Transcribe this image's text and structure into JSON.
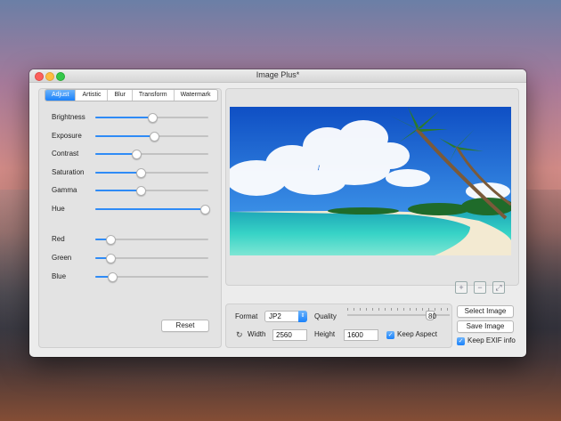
{
  "window": {
    "title": "Image Plus*"
  },
  "tabs": [
    "Adjust",
    "Artistic",
    "Blur",
    "Transform",
    "Watermark"
  ],
  "active_tab": 0,
  "adjust_sliders": [
    {
      "label": "Brightness",
      "value": 0.5
    },
    {
      "label": "Exposure",
      "value": 0.52
    },
    {
      "label": "Contrast",
      "value": 0.36
    },
    {
      "label": "Saturation",
      "value": 0.4
    },
    {
      "label": "Gamma",
      "value": 0.4
    },
    {
      "label": "Hue",
      "value": 0.97
    }
  ],
  "color_sliders": [
    {
      "label": "Red",
      "value": 0.13
    },
    {
      "label": "Green",
      "value": 0.13
    },
    {
      "label": "Blue",
      "value": 0.15
    }
  ],
  "reset_label": "Reset",
  "output": {
    "format_label": "Format",
    "format_value": "JP2",
    "quality_label": "Quality",
    "quality_value": "80",
    "quality_fraction": 0.8,
    "width_label": "Width",
    "width_value": "2560",
    "height_label": "Height",
    "height_value": "1600",
    "keep_aspect_label": "Keep Aspect",
    "keep_aspect_checked": true
  },
  "actions": {
    "select_image": "Select Image",
    "save_image": "Save Image",
    "keep_exif_label": "Keep EXIF info",
    "keep_exif_checked": true
  },
  "zoom_controls": [
    "+",
    "−",
    "⤢"
  ],
  "colors": {
    "accent": "#1a82fb",
    "sea": "#2ec6c0",
    "sky": "#1c64d8",
    "sand": "#f3ead2"
  }
}
